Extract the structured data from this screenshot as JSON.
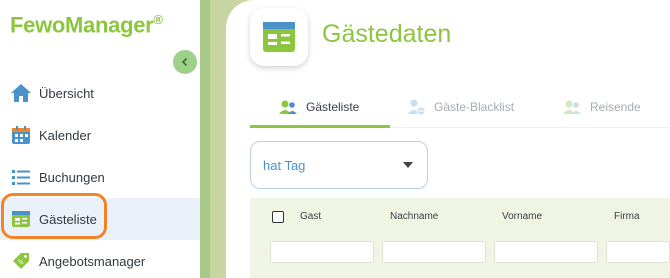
{
  "app": {
    "logo_left": "Fewo",
    "logo_right": "Manager",
    "logo_reg": "®"
  },
  "sidebar": {
    "items": [
      {
        "label": "Übersicht",
        "icon": "home-icon"
      },
      {
        "label": "Kalender",
        "icon": "calendar-icon"
      },
      {
        "label": "Buchungen",
        "icon": "list-icon"
      },
      {
        "label": "Gästeliste",
        "icon": "guest-card-icon",
        "active": true
      },
      {
        "label": "Angebotsmanager",
        "icon": "price-tag-icon"
      }
    ]
  },
  "page": {
    "title": "Gästedaten"
  },
  "tabs": [
    {
      "label": "Gästeliste",
      "icon": "guests-icon",
      "active": true
    },
    {
      "label": "Gäste-Blacklist",
      "icon": "blacklist-icon"
    },
    {
      "label": "Reisende",
      "icon": "travelers-icon"
    }
  ],
  "filter": {
    "value": "hat Tag"
  },
  "table": {
    "columns": [
      "Gast",
      "Nachname",
      "Vorname",
      "Firma"
    ]
  },
  "colors": {
    "accent_green": "#8cc63f",
    "highlight_orange": "#f08528",
    "link_blue": "#4a92c9"
  }
}
